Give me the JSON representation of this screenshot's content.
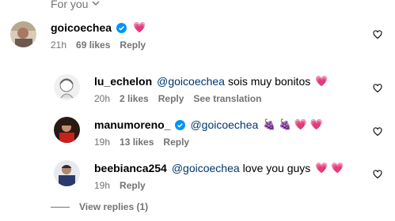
{
  "header": {
    "filter_label": "For you"
  },
  "comments": [
    {
      "username": "goicoechea",
      "verified": true,
      "mention": "",
      "text": "",
      "emoji": "💗",
      "time": "21h",
      "likes": "69 likes",
      "reply": "Reply",
      "translate": ""
    },
    {
      "username": "lu_echelon",
      "verified": false,
      "mention": "@goicoechea",
      "text": "sois muy bonitos",
      "emoji": "💗",
      "time": "20h",
      "likes": "2 likes",
      "reply": "Reply",
      "translate": "See translation"
    },
    {
      "username": "manumoreno_",
      "verified": true,
      "mention": "@goicoechea",
      "text": "",
      "emoji": "🍇 🍇 💗 💗",
      "time": "19h",
      "likes": "13 likes",
      "reply": "Reply",
      "translate": ""
    },
    {
      "username": "beebianca254",
      "verified": false,
      "mention": "@goicoechea",
      "text": "love you guys",
      "emoji": "💗 💗",
      "time": "19h",
      "likes": "",
      "reply": "Reply",
      "translate": ""
    }
  ],
  "view_replies": "View replies (1)",
  "colors": {
    "verified": "#0095f6",
    "mention": "#00376b",
    "muted": "#737373"
  }
}
